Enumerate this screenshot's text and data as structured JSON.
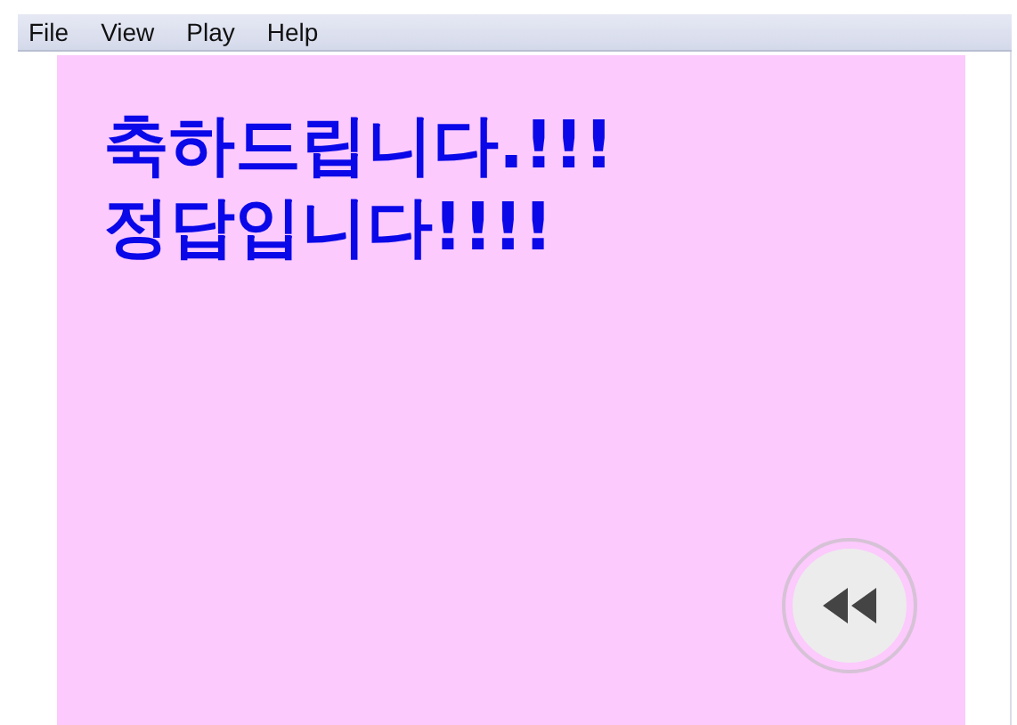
{
  "menu": [
    "File",
    "View",
    "Play",
    "Help"
  ],
  "stage": {
    "lines": [
      "축하드립니다.!!!",
      "정답입니다!!!!"
    ]
  }
}
